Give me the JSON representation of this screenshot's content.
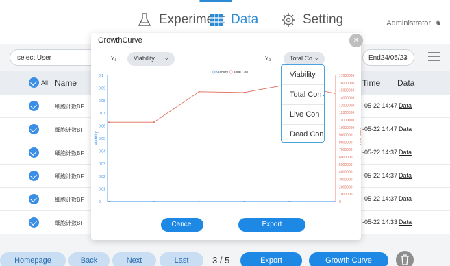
{
  "nav": {
    "experiment": "Experiment",
    "data": "Data",
    "setting": "Setting",
    "admin": "Administrator"
  },
  "toolbar": {
    "select_user": "select User",
    "end_date": "End24/05/23"
  },
  "table": {
    "all": "All",
    "name": "Name",
    "time": "Time",
    "data": "Data",
    "rows": [
      {
        "name": "细胞计数BF",
        "time": "-05-22 14:47",
        "link": "Data"
      },
      {
        "name": "细胞计数BF",
        "time": "-05-22 14:47",
        "link": "Data"
      },
      {
        "name": "细胞计数BF",
        "time": "-05-22 14:37",
        "link": "Data"
      },
      {
        "name": "细胞计数BF",
        "time": "-05-22 14:37",
        "link": "Data"
      },
      {
        "name": "细胞计数BF",
        "time": "-05-22 14:37",
        "link": "Data"
      },
      {
        "name": "细胞计数BF",
        "time": "-05-22 14:33",
        "link": "Data"
      }
    ]
  },
  "bottom": {
    "homepage": "Homepage",
    "back": "Back",
    "next": "Next",
    "last": "Last",
    "pager": "3 / 5",
    "export": "Export",
    "growth_curve": "Growth Curve"
  },
  "modal": {
    "title": "GrowthCurve",
    "y1_label": "Y₁",
    "y1_value": "Viability",
    "y2_label": "Y₂",
    "y2_value": "Total Co",
    "cancel": "Cancel",
    "export": "Export",
    "dropdown": [
      "Viability",
      "Total Con",
      "Live Con",
      "Dead Con"
    ],
    "dropdown_selected": "Total Con"
  },
  "chart_data": {
    "type": "line",
    "legend": [
      "Viability",
      "Total Con"
    ],
    "legend_position": "top",
    "ylabel_left": "Viability",
    "ylabel_right": "Total Con",
    "left_ticks": [
      "0",
      "0.01",
      "0.02",
      "0.03",
      "0.04",
      "0.05",
      "0.06",
      "0.07",
      "0.08",
      "0.09",
      "0.1"
    ],
    "right_ticks": [
      "0",
      "1000000",
      "2000000",
      "3000000",
      "4000000",
      "5000000",
      "6000000",
      "7000000",
      "8000000",
      "9000000",
      "10000000",
      "11000000",
      "12000000",
      "13000000",
      "14000000",
      "15000000",
      "16000000",
      "17000000"
    ],
    "ylim_left": [
      0,
      0.1
    ],
    "ylim_right": [
      0,
      17000000
    ],
    "x_count": 6,
    "series": [
      {
        "name": "Viability",
        "axis": "left",
        "color": "#3a8ee6",
        "values": [
          0,
          0,
          0,
          0,
          0,
          0
        ]
      },
      {
        "name": "Total Con",
        "axis": "right",
        "color": "#e06c5a",
        "values": [
          10700000,
          10700000,
          14800000,
          14700000,
          15800000,
          14600000
        ]
      }
    ],
    "grid": false
  },
  "colors": {
    "accent": "#1e88e5",
    "viability": "#3a8ee6",
    "total": "#e06c5a"
  }
}
